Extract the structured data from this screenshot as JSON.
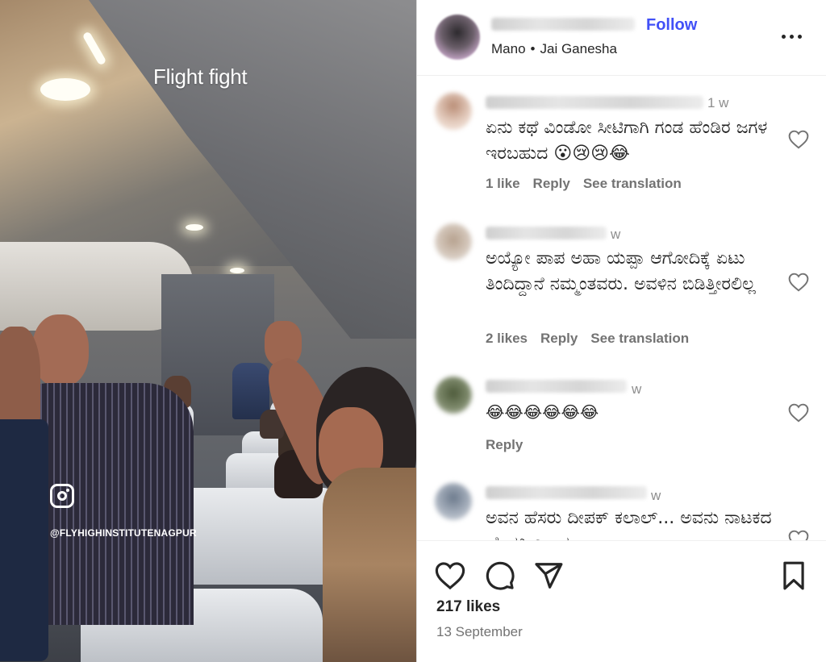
{
  "media": {
    "overlay_title": "Flight fight",
    "watermark": "@FLYHIGHINSTITUTENAGPUR"
  },
  "header": {
    "follow_label": "Follow",
    "music_artist": "Mano",
    "music_separator": "•",
    "music_title": "Jai Ganesha"
  },
  "comments": [
    {
      "time": "1 w",
      "text": "ಏನು ಕಥೆ ವಿಂಡೋ ಸೀಟಿಗಾಗಿ ಗಂಡ ಹೆಂಡಿರ ಜಗಳ ಇರಬಹುದ 😮😢😢😂",
      "likes": "1 like",
      "reply": "Reply",
      "translate": "See translation"
    },
    {
      "time": "w",
      "text": "ಅಯ್ಯೋ ಪಾಪ ಅಹಾ ಯಪ್ಪಾ ಆಗೋದಿಕ್ಕೆ ಏಟು ತಿಂದಿದ್ದಾನೆ ನಮ್ಮಂತವರು. ಅವಳಿನ ಬಿಡಿತ್ತೀರಲಿಲ್ಲ",
      "likes": "2 likes",
      "reply": "Reply",
      "translate": "See translation"
    },
    {
      "time": "w",
      "text": "😂😂😂😂😂😂",
      "reply": "Reply"
    },
    {
      "time": "w",
      "text": "ಅವನ ಹೆಸರು ದೀಪಕ್ ಕಲಾಲ್... ಅವನು ನಾಟಕದ ಹೆಂಡತಿ ಎಲ್ಲದ"
    }
  ],
  "footer": {
    "likes_count": "217 likes",
    "date": "13 September"
  },
  "colors": {
    "accent": "#4150f7",
    "text": "#262626",
    "secondary": "#737373"
  }
}
